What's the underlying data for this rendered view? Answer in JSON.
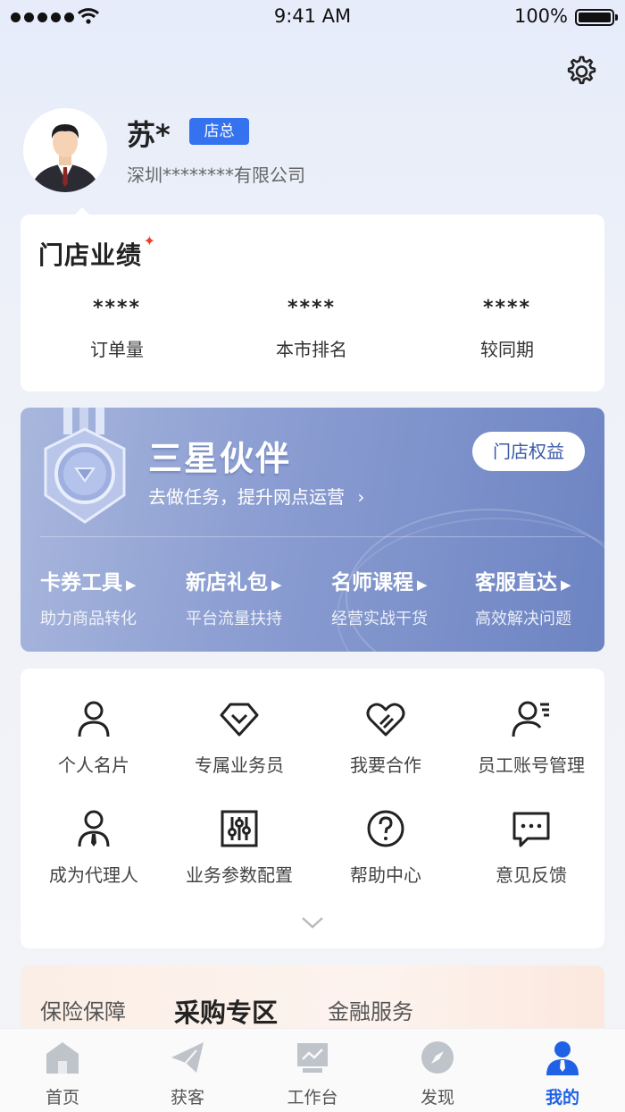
{
  "status_bar": {
    "time": "9:41 AM",
    "battery": "100%"
  },
  "profile": {
    "name": "苏*",
    "role": "店总",
    "company": "深圳********有限公司"
  },
  "performance": {
    "title": "门店业绩",
    "stats": [
      {
        "value": "****",
        "label": "订单量"
      },
      {
        "value": "****",
        "label": "本市排名"
      },
      {
        "value": "****",
        "label": "较同期"
      }
    ]
  },
  "partner_banner": {
    "title": "三星伙伴",
    "subtitle": "去做任务，提升网点运营",
    "rights_button": "门店权益",
    "perks": [
      {
        "title": "卡券工具",
        "desc": "助力商品转化"
      },
      {
        "title": "新店礼包",
        "desc": "平台流量扶持"
      },
      {
        "title": "名师课程",
        "desc": "经营实战干货"
      },
      {
        "title": "客服直达",
        "desc": "高效解决问题"
      }
    ]
  },
  "tools": [
    {
      "label": "个人名片",
      "icon": "person-icon"
    },
    {
      "label": "专属业务员",
      "icon": "diamond-icon"
    },
    {
      "label": "我要合作",
      "icon": "handshake-heart-icon"
    },
    {
      "label": "员工账号管理",
      "icon": "staff-list-icon"
    },
    {
      "label": "成为代理人",
      "icon": "agent-tie-icon"
    },
    {
      "label": "业务参数配置",
      "icon": "sliders-icon"
    },
    {
      "label": "帮助中心",
      "icon": "help-icon"
    },
    {
      "label": "意见反馈",
      "icon": "feedback-icon"
    }
  ],
  "service_tabs": [
    {
      "label": "保险保障"
    },
    {
      "label": "采购专区",
      "active": true
    },
    {
      "label": "金融服务"
    }
  ],
  "bottom_nav": [
    {
      "label": "首页",
      "icon": "home-icon"
    },
    {
      "label": "获客",
      "icon": "send-icon"
    },
    {
      "label": "工作台",
      "icon": "workbench-icon"
    },
    {
      "label": "发现",
      "icon": "compass-icon"
    },
    {
      "label": "我的",
      "icon": "profile-icon",
      "active": true
    }
  ],
  "colors": {
    "accent": "#1f62e6",
    "badge": "#3472ef",
    "banner": "#8c9ed2"
  }
}
